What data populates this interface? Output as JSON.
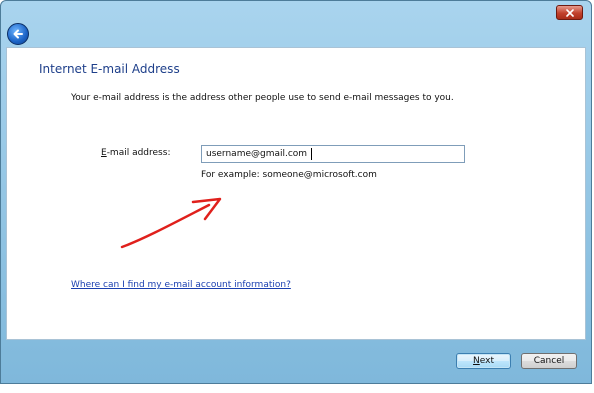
{
  "window": {
    "back_icon": "back-arrow-icon",
    "close_icon": "close-x-icon",
    "accent_color": "#1e3f8a"
  },
  "page": {
    "heading": "Internet E-mail Address",
    "intro": "Your e-mail address is the address other people use to send e-mail messages to you.",
    "email_label_mnemonic": "E",
    "email_label_rest": "-mail address:",
    "email_value": "username@gmail.com",
    "example": "For example: someone@microsoft.com",
    "help_link": "Where can I find my e-mail account information?"
  },
  "footer": {
    "next_mnemonic": "N",
    "next_rest": "ext",
    "cancel_label": "Cancel"
  },
  "annotation": {
    "arrow_color": "#e0201c"
  }
}
